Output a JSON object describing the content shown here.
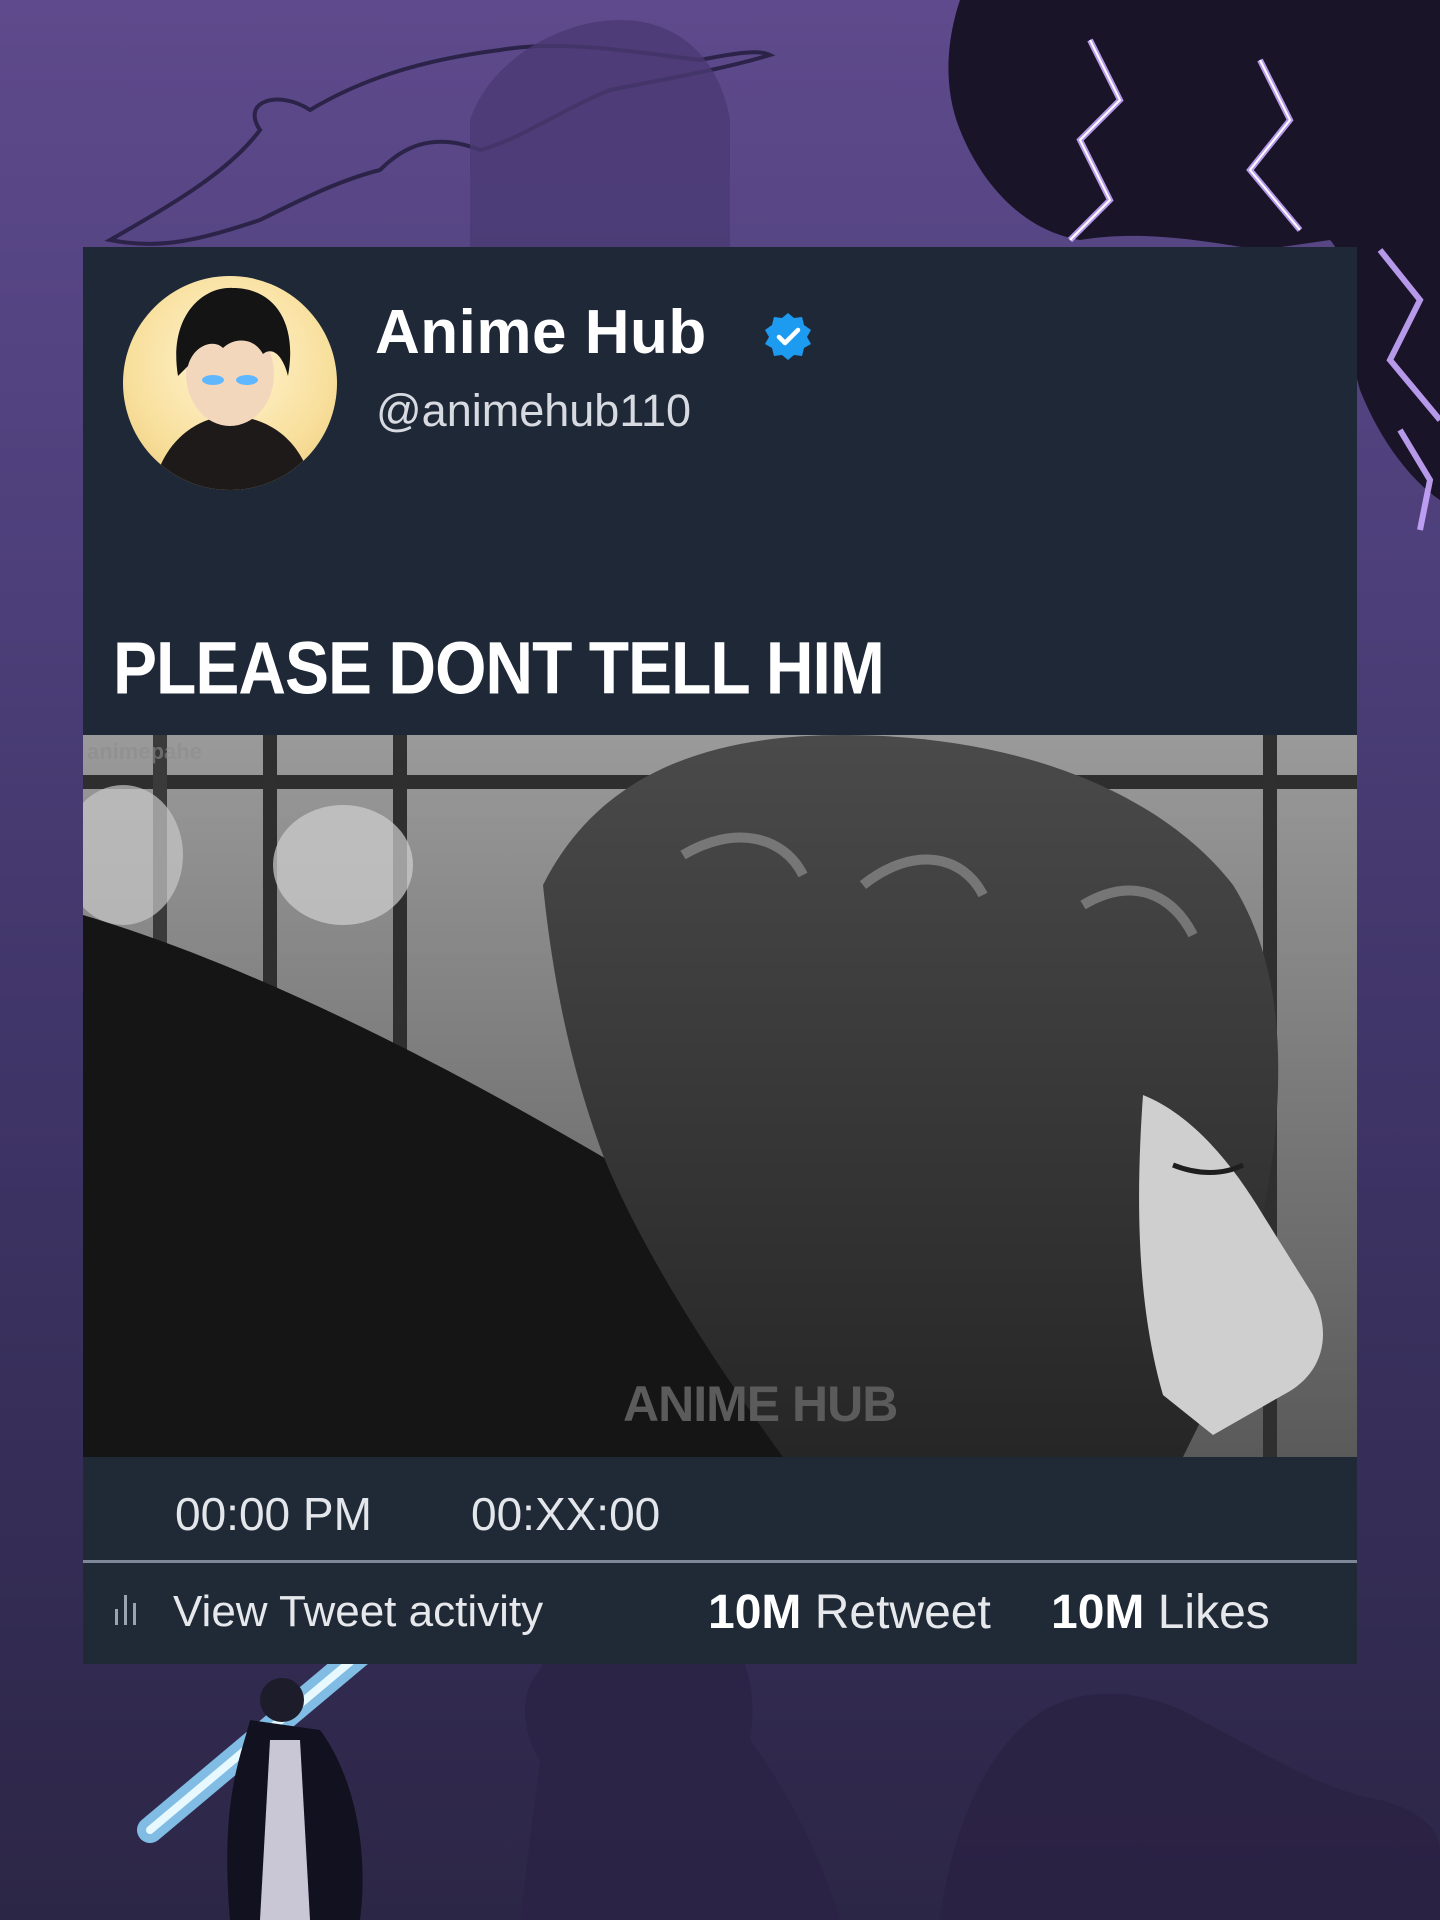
{
  "tweet": {
    "display_name": "Anime Hub",
    "handle": "@animehub110",
    "text": "PLEASE DONT TELL HIM",
    "media_watermark_top": "animepahe",
    "media_watermark": "ANIME HUB",
    "time": "00:00 PM",
    "date": "00:XX:00",
    "activity_label": "View Tweet activity",
    "retweet_count": "10M",
    "retweet_label": "Retweet",
    "likes_count": "10M",
    "likes_label": "Likes"
  },
  "icons": {
    "verified": "verified-badge-icon",
    "activity": "bar-chart-icon"
  },
  "colors": {
    "card_background": "#1f2837",
    "verified_blue": "#1d9bf0",
    "background_purple": "#5e4a8c"
  }
}
